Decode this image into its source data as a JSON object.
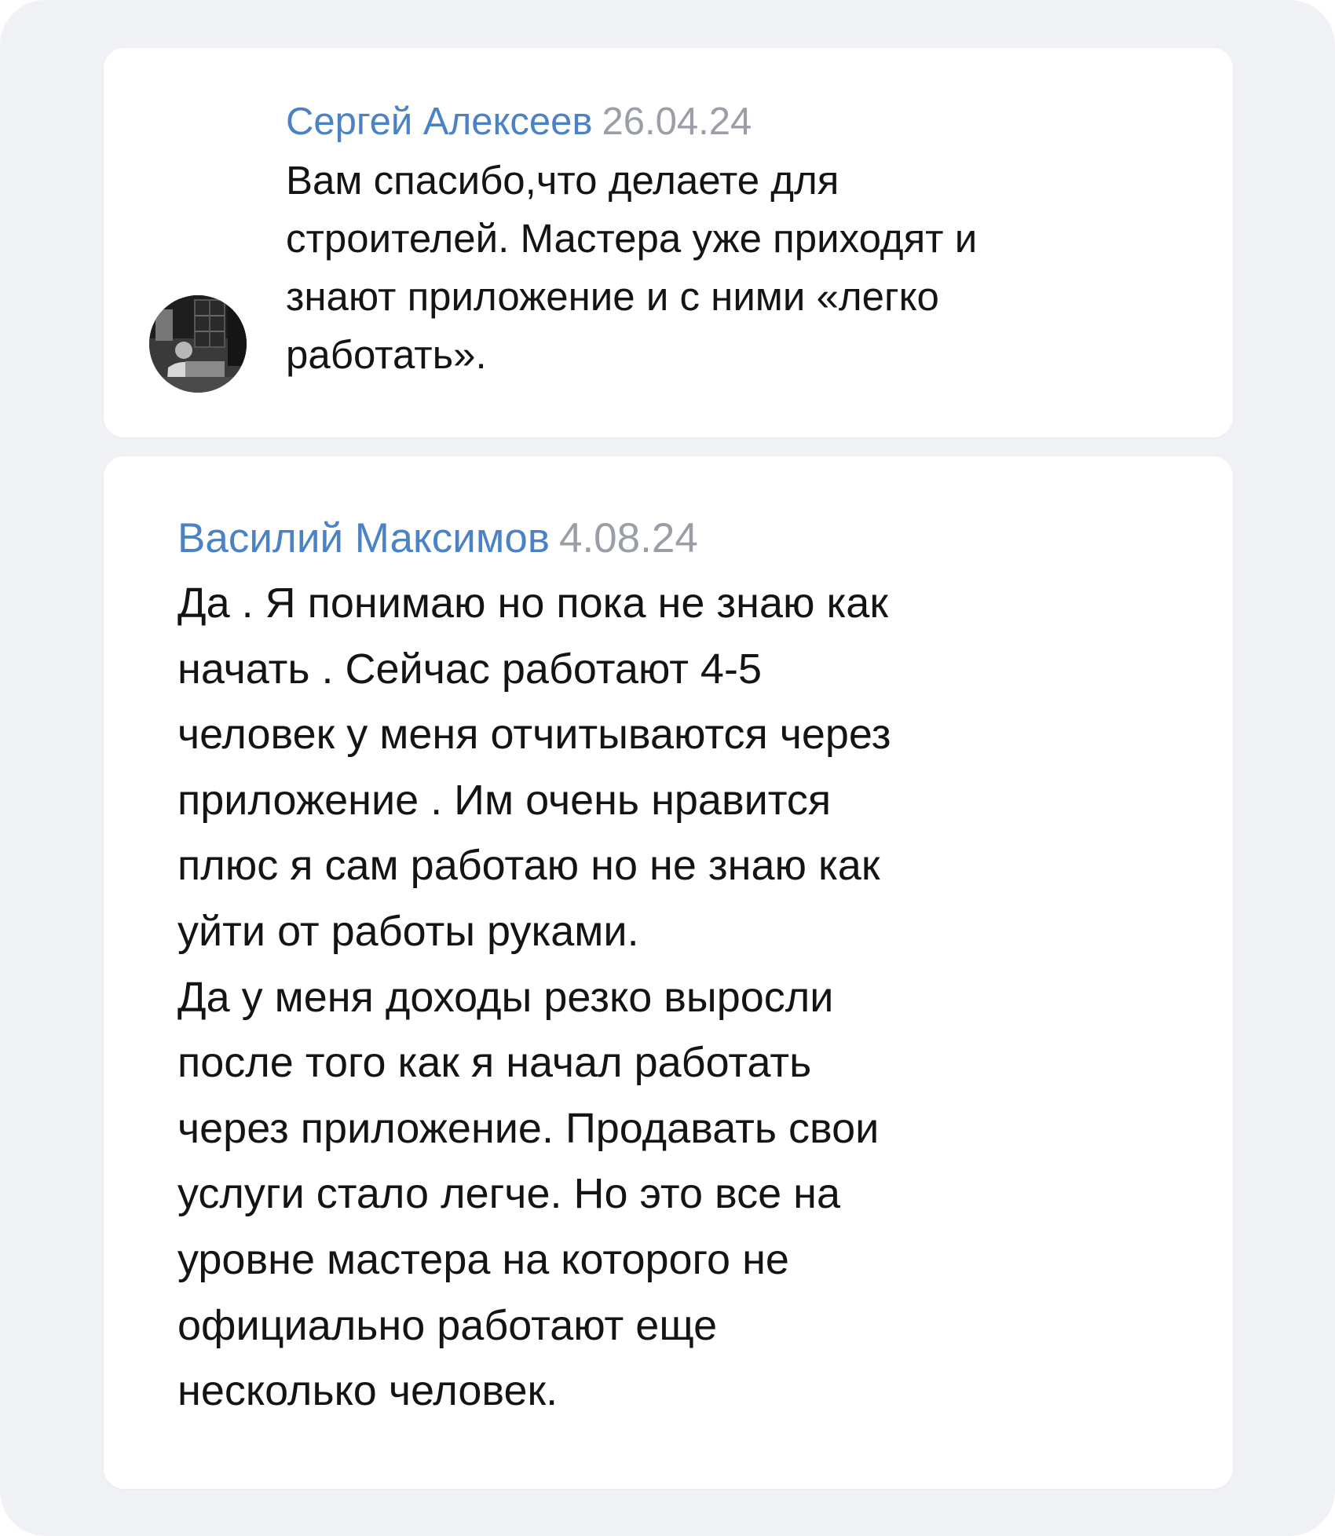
{
  "comments": [
    {
      "author": "Сергей Алексеев",
      "date": "26.04.24",
      "lines": [
        "Вам спасибо,что делаете для",
        "строителей. Мастера уже приходят и",
        "знают приложение и с ними «легко",
        "работать»."
      ]
    },
    {
      "author": "Василий Максимов",
      "date": "4.08.24",
      "lines": [
        "Да . Я понимаю но пока не знаю как",
        "начать . Сейчас работают 4-5",
        "человек у меня отчитываются через",
        "приложение . Им очень нравится",
        "плюс я сам работаю но не знаю как",
        "уйти от работы руками.",
        "Да у меня доходы резко выросли",
        "после того как я начал работать",
        "через приложение. Продавать свои",
        "услуги стало легче. Но это все на",
        "уровне мастера на которого не",
        "официально работают еще",
        "несколько человек."
      ]
    }
  ],
  "colors": {
    "background": "#f0f1f5",
    "card": "#ffffff",
    "author": "#4b82c6",
    "date": "#9a9ea6",
    "text": "#141414"
  },
  "icons": {
    "avatar": "user-photo-avatar"
  }
}
